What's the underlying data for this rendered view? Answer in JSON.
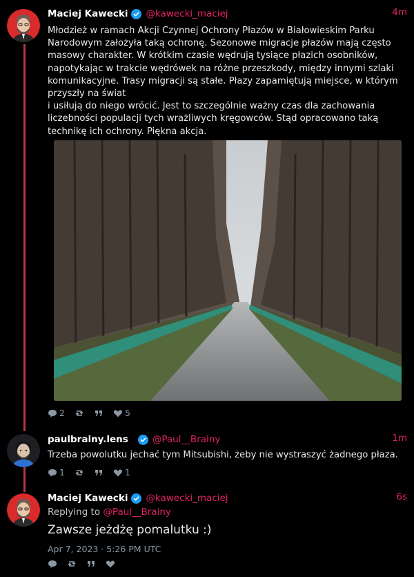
{
  "posts": [
    {
      "author": {
        "name": "Maciej Kawecki",
        "handle": "@kawecki_maciej"
      },
      "time": "4m",
      "text": "Młodzież w ramach Akcji Czynnej Ochrony Płazów w Białowieskim Parku Narodowym założyła taką ochronę. Sezonowe migracje płazów mają często masowy charakter. W krótkim czasie wędrują tysiące płazich osobników, napotykając w trakcie wędrówek na różne przeszkody, między innymi szlaki komunikacyjne. Trasy migracji są stałe. Płazy zapamiętują miejsce, w którym przyszły na świat\ni usiłują do niego wrócić. Jest to szczególnie ważny czas dla zachowania liczebności populacji tych wrażliwych kręgowców. Stąd opracowano taką technikę ich ochrony. Piękna akcja.",
      "actions": {
        "replies": "2",
        "retweets": "",
        "quotes": "",
        "likes": "5"
      }
    },
    {
      "author": {
        "name": "paulbrainy.lens",
        "handle": "@Paul__Brainy"
      },
      "time": "1m",
      "text": "Trzeba powolutku jechać tym Mitsubishi, żeby nie wystraszyć żadnego płaza.",
      "actions": {
        "replies": "1",
        "retweets": "",
        "quotes": "",
        "likes": "1"
      }
    },
    {
      "author": {
        "name": "Maciej Kawecki",
        "handle": "@kawecki_maciej"
      },
      "time": "6s",
      "replying_label": "Replying to",
      "replying_handle": "@Paul__Brainy",
      "text": "Zawsze jeżdżę pomalutku :)",
      "date": "Apr 7, 2023 · 5:26 PM UTC",
      "actions": {
        "replies": "",
        "retweets": "",
        "quotes": "",
        "likes": ""
      }
    }
  ],
  "colors": {
    "accent": "#e0245e",
    "thread": "#b23a48",
    "verified": "#1d9bf0",
    "muted": "#8b98a5"
  }
}
